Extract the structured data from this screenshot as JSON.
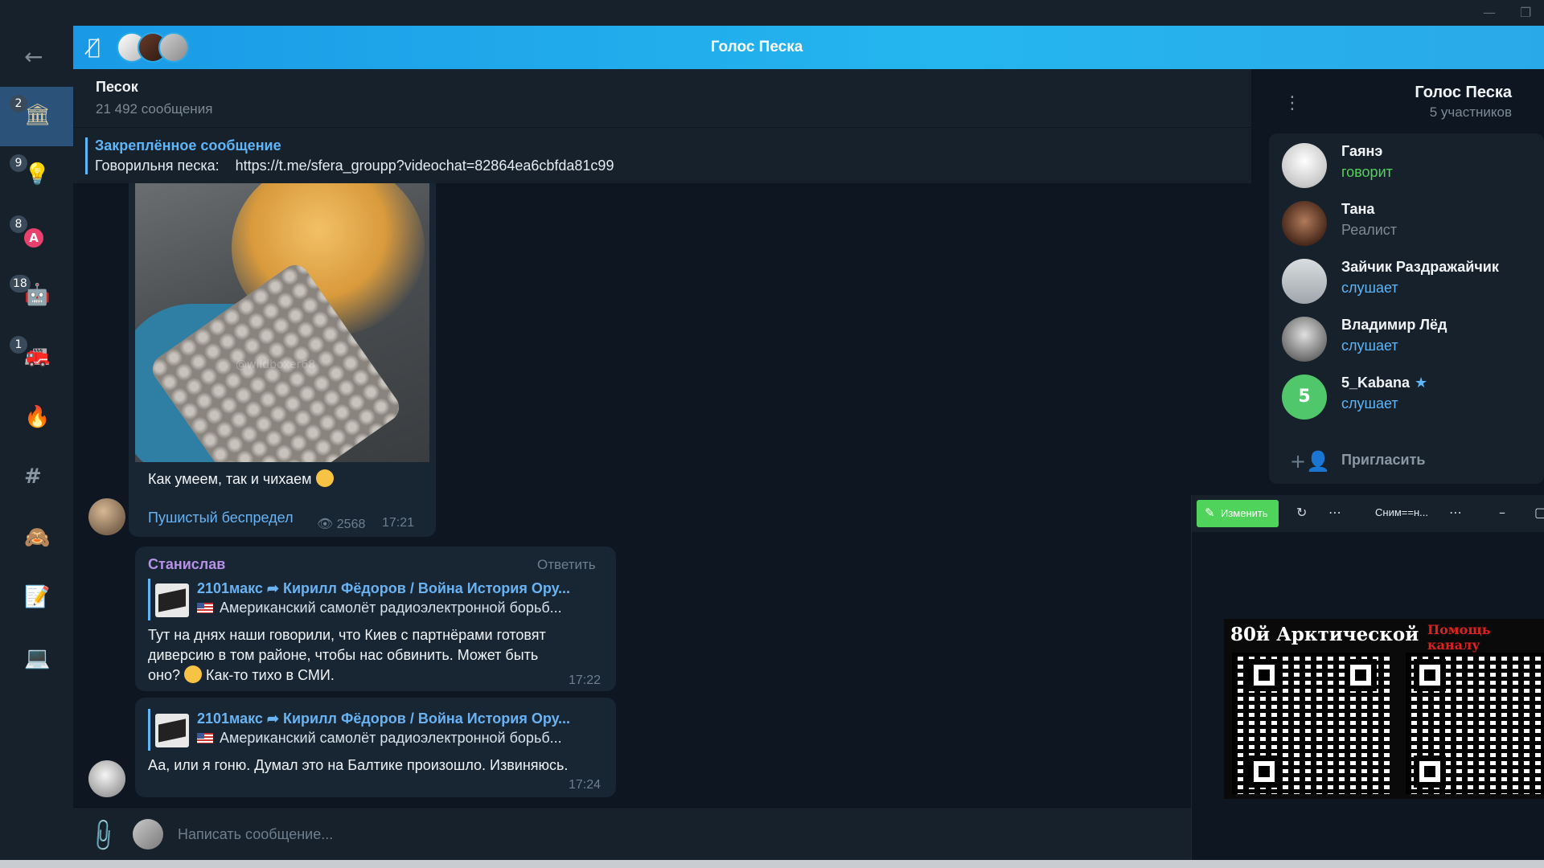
{
  "call": {
    "title": "Голос Песка",
    "mic_icon": "mic-off-icon"
  },
  "rail": {
    "back_icon": "arrow-left-icon",
    "folders": [
      {
        "count": "2",
        "icon": "bank-icon",
        "active": true
      },
      {
        "count": "9",
        "icon": "bulb-icon"
      },
      {
        "count": "8",
        "icon": "letter-a-icon"
      },
      {
        "count": "18",
        "icon": "robot-icon"
      },
      {
        "count": "1",
        "icon": "fire-truck-icon"
      },
      {
        "count": "",
        "icon": "fire-icon"
      },
      {
        "count": "",
        "icon": "hashtag-icon"
      },
      {
        "count": "",
        "icon": "monkey-icon"
      },
      {
        "count": "",
        "icon": "memo-icon"
      },
      {
        "count": "",
        "icon": "laptop-icon"
      }
    ]
  },
  "chat": {
    "name": "Песок",
    "subtitle": "21 492 сообщения"
  },
  "pinned": {
    "title": "Закреплённое сообщение",
    "text": "Говорильня песка:    https://t.me/sfera_groupp?videochat=82864ea6cbfda81c99"
  },
  "messages": {
    "media_post": {
      "watermark": "@wildboxer68",
      "caption": "Как умеем, так и чихаем",
      "channel": "Пушистый беспредел",
      "views": "2568",
      "time": "17:21"
    },
    "msg1": {
      "sender": "Станислав",
      "reply_label": "Ответить",
      "fwd_title": "2101макс ➦ Кирилл Фёдоров / Война История Ору...",
      "fwd_sub": "Американский самолёт радиоэлектронной борьб...",
      "text_line1": "Тут на днях наши говорили, что Киев с партнёрами готовят",
      "text_line2": "диверсию в том районе, чтобы нас обвинить. Может быть",
      "text_line3": "оно?",
      "text_line3b": "Как-то тихо в СМИ.",
      "time": "17:22"
    },
    "msg2": {
      "fwd_title": "2101макс ➦ Кирилл Фёдоров / Война История Ору...",
      "fwd_sub": "Американский самолёт радиоэлектронной борьб...",
      "text": "Аа, или я гоню. Думал это на Балтике произошло. Извиняюсь.",
      "time": "17:24"
    }
  },
  "composer": {
    "placeholder": "Написать сообщение..."
  },
  "panel": {
    "title": "Голос Песка",
    "subtitle": "5 участников",
    "participants": [
      {
        "name": "Гаянэ",
        "status": "говорит",
        "status_color": "#4fd35a"
      },
      {
        "name": "Тана",
        "status": "Реалист",
        "status_color": "#7c8a96"
      },
      {
        "name": "Зайчик Раздражайчик",
        "status": "слушает",
        "status_color": "#5eb5f7"
      },
      {
        "name": "Владимир Лёд",
        "status": "слушает",
        "status_color": "#5eb5f7"
      },
      {
        "name": "5_Kabana",
        "status": "слушает",
        "status_color": "#5eb5f7",
        "initial": "5"
      }
    ],
    "invite_label": "Пригласить"
  },
  "video": {
    "edit_label": "Изменить",
    "snapshot_label": "Сним==н...",
    "screen_title": "80й Арктической",
    "screen_help": "Помощь каналу"
  }
}
